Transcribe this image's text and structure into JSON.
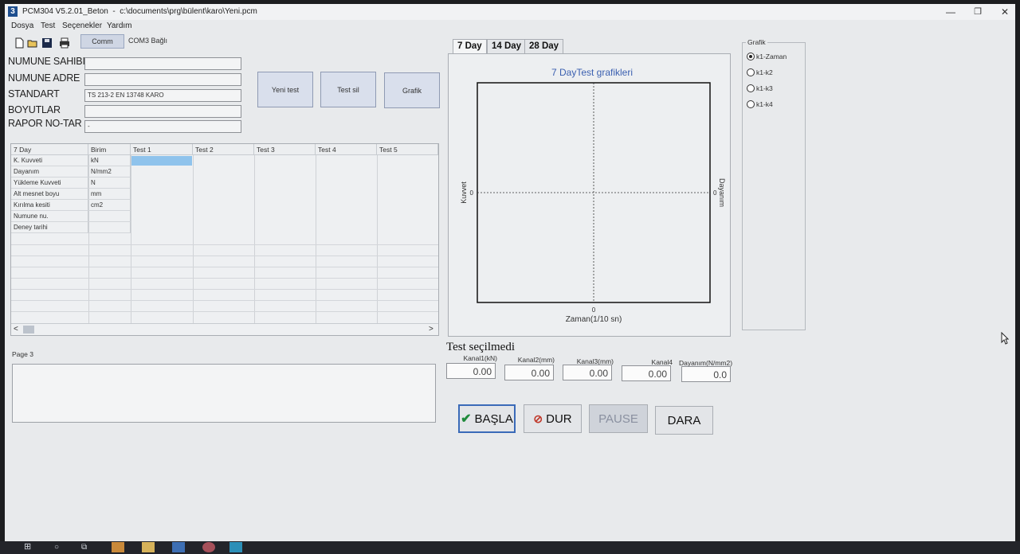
{
  "window": {
    "title": "PCM304 V5.2.01_Beton  -  c:\\documents\\prg\\bülent\\karo\\Yeni.pcm",
    "app_icon": "3",
    "minimize": "—",
    "maximize": "❐",
    "close": "✕"
  },
  "menu": [
    "Dosya",
    "Test",
    "Seçenekler",
    "Yardım"
  ],
  "toolbar": {
    "icons": [
      "new-file-icon",
      "open-folder-icon",
      "save-icon",
      "print-icon"
    ],
    "comm_label": "Comm",
    "com_status": "COM3 Bağlı"
  },
  "form": {
    "fields": [
      {
        "label": "NUMUNE SAHIBI",
        "value": ""
      },
      {
        "label": "NUMUNE ADRE",
        "value": ""
      },
      {
        "label": "STANDART",
        "value": "TS 213-2 EN 13748 KARO"
      },
      {
        "label": "BOYUTLAR",
        "value": ""
      },
      {
        "label": "RAPOR NO-TAR",
        "value": "-"
      }
    ],
    "buttons": [
      "Yeni test",
      "Test sil",
      "Grafik"
    ]
  },
  "grid": {
    "headers": [
      "7 Day",
      "Birim",
      "Test 1",
      "Test 2",
      "Test 3",
      "Test 4",
      "Test 5"
    ],
    "rows": [
      {
        "label": "K. Kuvveti",
        "unit": "kN"
      },
      {
        "label": "Dayanım",
        "unit": "N/mm2"
      },
      {
        "label": "Yükleme Kuvveti",
        "unit": "N"
      },
      {
        "label": "Alt mesnet boyu",
        "unit": "mm"
      },
      {
        "label": "Kırılma kesiti",
        "unit": "cm2"
      },
      {
        "label": "Numune nu.",
        "unit": ""
      },
      {
        "label": "Deney tarihi",
        "unit": ""
      }
    ],
    "scroll_left": "<",
    "scroll_right": ">"
  },
  "page3": {
    "label": "Page 3",
    "value": ""
  },
  "tabs": [
    "7 Day",
    "14 Day",
    "28 Day"
  ],
  "chart": {
    "title": "7 DayTest grafikleri",
    "ylabel_left": "Kuvvet",
    "ylabel_right": "Dayanım",
    "xlabel": "Zaman(1/10 sn)",
    "x_tick": "0",
    "y_tick_left": "0",
    "y_tick_right": "0"
  },
  "grafik": {
    "title": "Grafik",
    "options": [
      {
        "label": "k1-Zaman",
        "selected": true
      },
      {
        "label": "k1-k2",
        "selected": false
      },
      {
        "label": "k1-k3",
        "selected": false
      },
      {
        "label": "k1-k4",
        "selected": false
      }
    ]
  },
  "status": {
    "text": "Test seçilmedi"
  },
  "channels": [
    {
      "label": "Kanal1(kN)",
      "value": "0.00"
    },
    {
      "label": "Kanal2(mm)",
      "value": "0.00"
    },
    {
      "label": "Kanal3(mm)",
      "value": "0.00"
    },
    {
      "label": "Kanal4",
      "value": "0.00"
    },
    {
      "label": "Dayanım(N/mm2)",
      "value": "0.0"
    }
  ],
  "actions": {
    "start": "BAŞLA",
    "stop": "DUR",
    "pause": "PAUSE",
    "tare": "DARA"
  },
  "colors": {
    "window_bg": "#e8eaec",
    "chart_title": "#3a5fb0",
    "selected_cell": "#8fc3ec",
    "start_check": "#1f8a3a",
    "stop_icon": "#c0392b",
    "pause_disabled": "#cfd3da"
  }
}
